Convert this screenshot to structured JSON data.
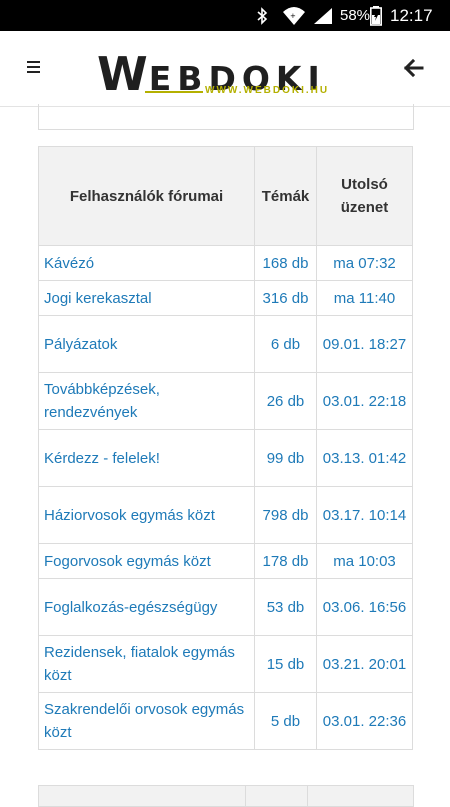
{
  "status_bar": {
    "battery": "58%",
    "time": "12:17",
    "icons": [
      "bluetooth-icon",
      "wifi-icon",
      "signal-icon",
      "battery-icon"
    ]
  },
  "header": {
    "logo_initial": "W",
    "logo_rest": "EBDOKI",
    "logo_sub": "WWW.WEBDOKI.HU",
    "icons": [
      "menu-icon",
      "back-arrow-icon"
    ]
  },
  "table": {
    "headers": {
      "forum": "Felhasználók fórumai",
      "topics": "Témák",
      "last_line1": "Utolsó",
      "last_line2": "üzenet"
    },
    "rows": [
      {
        "name": "Kávézó",
        "topics": "168 db",
        "last": "ma 07:32"
      },
      {
        "name": "Jogi kerekasztal",
        "topics": "316 db",
        "last": "ma 11:40"
      },
      {
        "name": "Pályázatok",
        "topics": "6 db",
        "last": "09.01. 18:27"
      },
      {
        "name": "Továbbképzések, rendezvények",
        "topics": "26 db",
        "last": "03.01. 22:18"
      },
      {
        "name": "Kérdezz - felelek!",
        "topics": "99 db",
        "last": "03.13. 01:42"
      },
      {
        "name": "Háziorvosok egymás közt",
        "topics": "798 db",
        "last": "03.17. 10:14"
      },
      {
        "name": "Fogorvosok egymás közt",
        "topics": "178 db",
        "last": "ma 10:03"
      },
      {
        "name": "Foglalkozás-egészségügy",
        "topics": "53 db",
        "last": "03.06. 16:56"
      },
      {
        "name": "Rezidensek, fiatalok egymás közt",
        "topics": "15 db",
        "last": "03.21. 20:01"
      },
      {
        "name": "Szakrendelői orvosok egymás közt",
        "topics": "5 db",
        "last": "03.01. 22:36"
      }
    ]
  },
  "colors": {
    "link": "#1e7ab8",
    "header_bg": "#f2f2f2",
    "border": "#dcdcdc",
    "logo_accent": "#b4b000",
    "status_bar": "#000000"
  }
}
